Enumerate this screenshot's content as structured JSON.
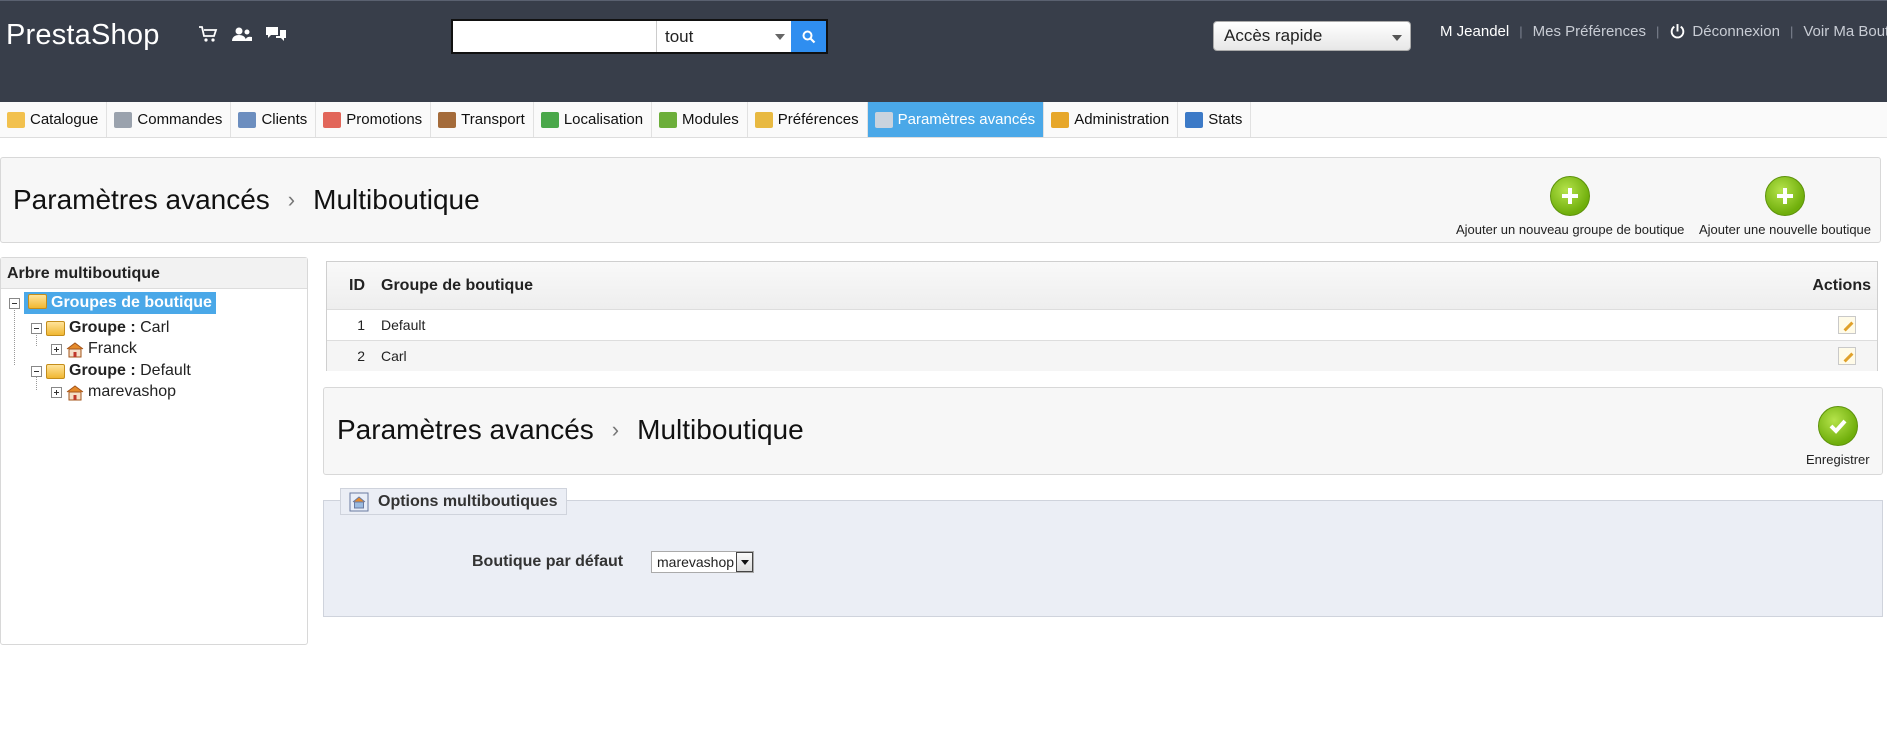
{
  "header": {
    "logo": "PrestaShop",
    "icons": [
      "cart-icon",
      "customers-icon",
      "messages-icon"
    ],
    "search": {
      "value": "",
      "placeholder": "",
      "scope": "tout"
    },
    "quick_access": "Accès rapide",
    "user": "M Jeandel",
    "links": {
      "preferences": "Mes Préférences",
      "logout": "Déconnexion",
      "view_shop": "Voir Ma Boutique"
    }
  },
  "nav": {
    "items": [
      {
        "label": "Catalogue",
        "color": "#f2c14e"
      },
      {
        "label": "Commandes",
        "color": "#9aa2ad"
      },
      {
        "label": "Clients",
        "color": "#6c8ebf"
      },
      {
        "label": "Promotions",
        "color": "#e2665a"
      },
      {
        "label": "Transport",
        "color": "#a46b3a"
      },
      {
        "label": "Localisation",
        "color": "#4aa84a"
      },
      {
        "label": "Modules",
        "color": "#6cae3a"
      },
      {
        "label": "Préférences",
        "color": "#e8b941"
      },
      {
        "label": "Paramètres avancés",
        "color": "#c9d3de"
      },
      {
        "label": "Administration",
        "color": "#e7a72a"
      },
      {
        "label": "Stats",
        "color": "#3c7ac7"
      }
    ],
    "active_index": 8
  },
  "toolbar1": {
    "crumb_parent": "Paramètres avancés",
    "crumb_current": "Multiboutique",
    "btn_add_group": "Ajouter un nouveau groupe de boutique",
    "btn_add_shop": "Ajouter une nouvelle boutique"
  },
  "tree": {
    "title": "Arbre multiboutique",
    "root": "Groupes de boutique",
    "group_label": "Groupe :",
    "group1": "Carl",
    "shop1": "Franck",
    "group2": "Default",
    "shop2": "marevashop"
  },
  "table": {
    "headers": {
      "id": "ID",
      "name": "Groupe de boutique",
      "actions": "Actions"
    },
    "rows": [
      {
        "id": "1",
        "name": "Default"
      },
      {
        "id": "2",
        "name": "Carl"
      }
    ]
  },
  "toolbar2": {
    "crumb_parent": "Paramètres avancés",
    "crumb_current": "Multiboutique",
    "btn_save": "Enregistrer"
  },
  "options": {
    "legend": "Options multiboutiques",
    "label": "Boutique par défaut",
    "selected": "marevashop"
  },
  "colors": {
    "header_bg": "#383e4a",
    "accent": "#4aa8e8",
    "success": "#6fae0b"
  }
}
